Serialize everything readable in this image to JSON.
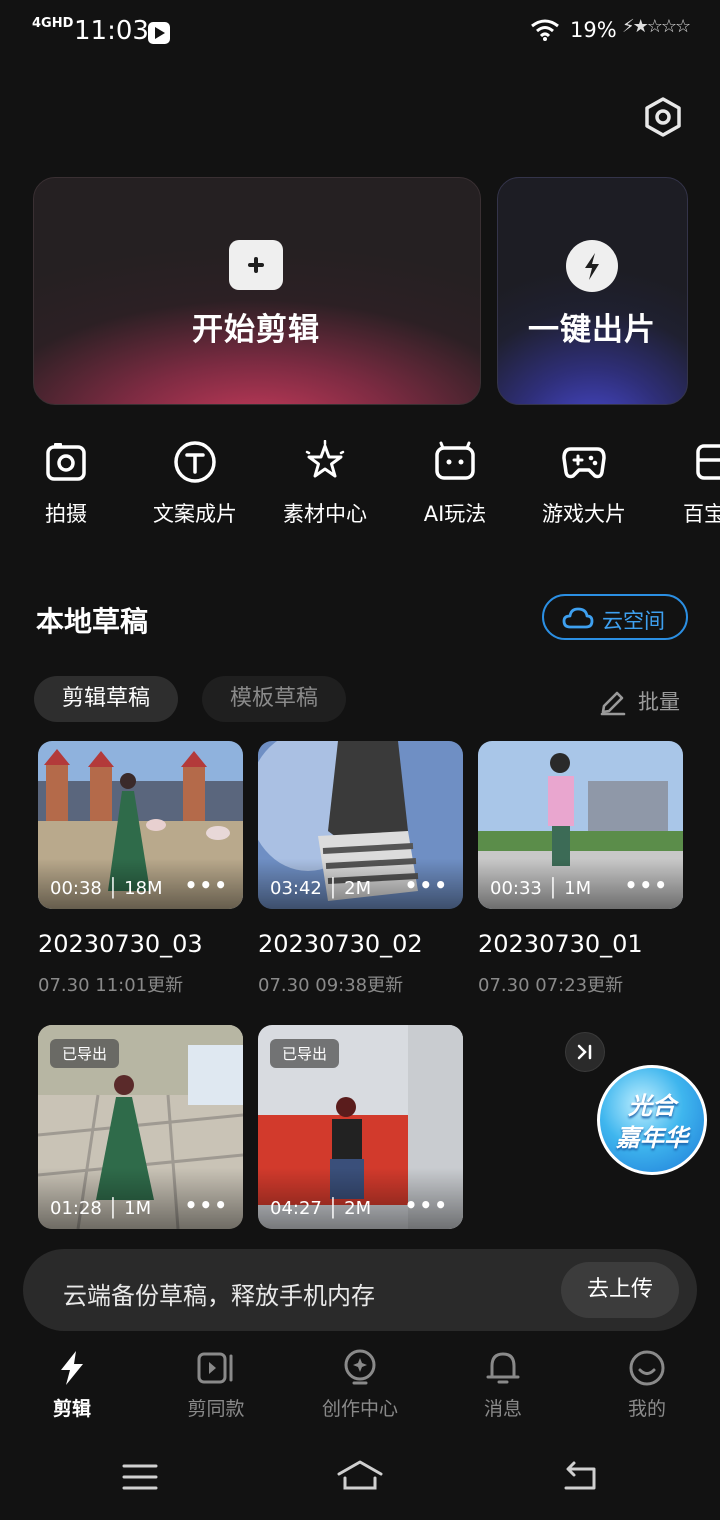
{
  "status_bar": {
    "network": "4GHD",
    "time": "11:03",
    "battery": "19%",
    "charging": "⚡★☆☆☆"
  },
  "cards": {
    "start_edit": "开始剪辑",
    "one_click": "一键出片"
  },
  "tools": [
    {
      "label": "拍摄",
      "icon": "camera-icon"
    },
    {
      "label": "文案成片",
      "icon": "text-t-icon"
    },
    {
      "label": "素材中心",
      "icon": "sparkle-star-icon"
    },
    {
      "label": "AI玩法",
      "icon": "ai-robot-icon"
    },
    {
      "label": "游戏大片",
      "icon": "gamepad-icon"
    },
    {
      "label": "百宝",
      "icon": "toolbox-icon"
    }
  ],
  "drafts": {
    "title": "本地草稿",
    "cloud_space": "云空间",
    "tab_edit": "剪辑草稿",
    "tab_template": "模板草稿",
    "batch": "批量",
    "items": [
      {
        "meta": "00:38 │ 18M",
        "name": "20230730_03",
        "date": "07.30 11:01更新"
      },
      {
        "meta": "03:42 │ 2M",
        "name": "20230730_02",
        "date": "07.30 09:38更新"
      },
      {
        "meta": "00:33 │ 1M",
        "name": "20230730_01",
        "date": "07.30 07:23更新"
      },
      {
        "meta": "01:28 │ 1M",
        "badge": "已导出"
      },
      {
        "meta": "04:27 │ 2M",
        "badge": "已导出"
      }
    ],
    "more": "•••"
  },
  "promo": {
    "line1": "光合",
    "line2": "嘉年华"
  },
  "backup": {
    "text": "云端备份草稿，释放手机内存",
    "button": "去上传"
  },
  "nav": [
    {
      "label": "剪辑",
      "icon": "bolt-icon",
      "active": true
    },
    {
      "label": "剪同款",
      "icon": "template-video-icon"
    },
    {
      "label": "创作中心",
      "icon": "bulb-icon"
    },
    {
      "label": "消息",
      "icon": "bell-icon"
    },
    {
      "label": "我的",
      "icon": "smiley-icon"
    }
  ],
  "colors": {
    "background": "#121212",
    "accent_blue": "#2b8fe3",
    "start_card_glow": "#c53a5a",
    "oneclick_card_glow": "#4a4bd6"
  }
}
